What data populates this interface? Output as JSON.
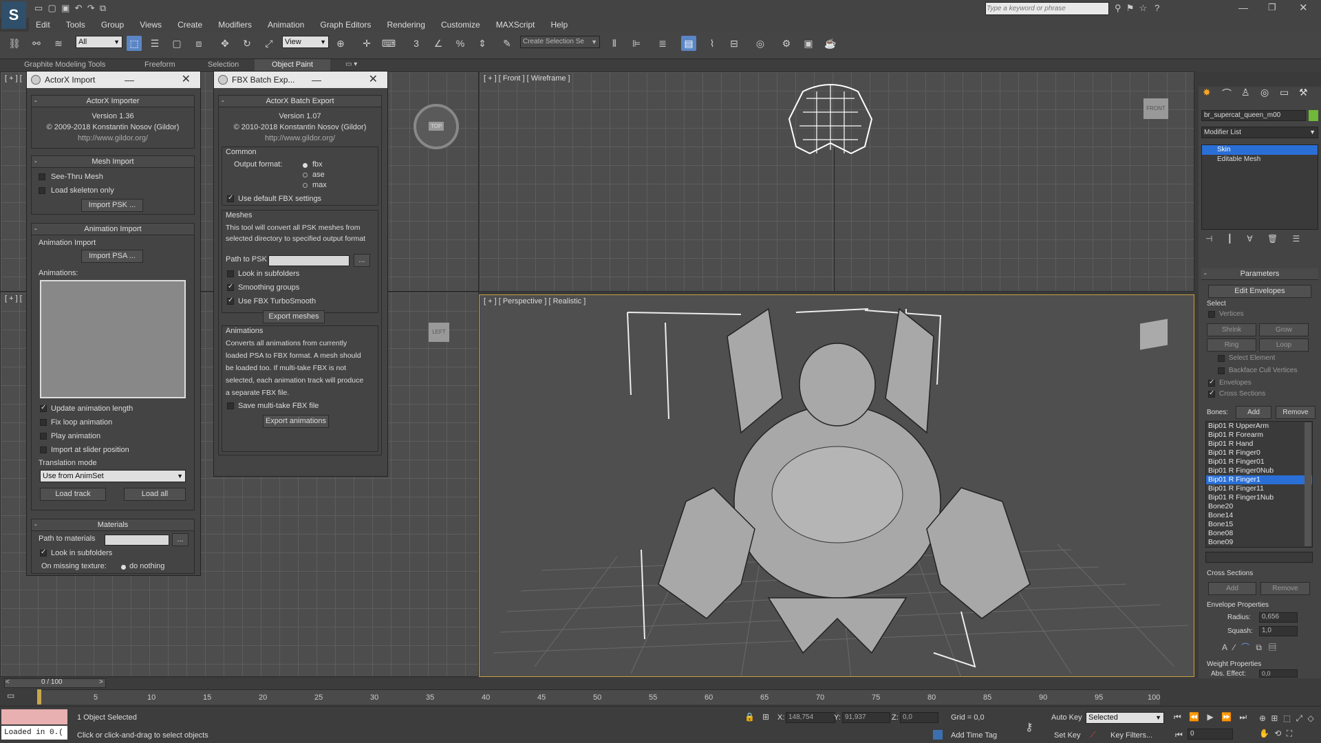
{
  "app": {
    "search_placeholder": "Type a keyword or phrase",
    "accent": "#5b86c5"
  },
  "menu": [
    "Edit",
    "Tools",
    "Group",
    "Views",
    "Create",
    "Modifiers",
    "Animation",
    "Graph Editors",
    "Rendering",
    "Customize",
    "MAXScript",
    "Help"
  ],
  "toolbar": {
    "selection_filter": "All",
    "ref_coord": "View",
    "named_selection": "Create Selection Se"
  },
  "ribbon_tabs": [
    "Graphite Modeling Tools",
    "Freeform",
    "Selection",
    "Object Paint"
  ],
  "viewports": {
    "front_label": "[ + ] [ Front ] [ Wireframe ]",
    "persp_label": "[ + ] [ Perspective ] [ Realistic ]",
    "tl_label": "[ + ] [",
    "ml_label": "[ + ] [",
    "front_cube": "FRONT",
    "top_cube": "TOP",
    "left_cube": "LEFT"
  },
  "actorx": {
    "title": "ActorX Import",
    "header": "ActorX Importer",
    "version": "Version 1.36",
    "copyright": "© 2009-2018 Konstantin Nosov (Gildor)",
    "url": "http://www.gildor.org/",
    "mesh_import": "Mesh Import",
    "see_thru": "See-Thru Mesh",
    "load_skeleton": "Load skeleton only",
    "import_psk": "Import PSK ...",
    "animation_import": "Animation Import",
    "anim_import_sub": "Animation Import",
    "import_psa": "Import PSA ...",
    "animations": "Animations:",
    "update_len": "Update animation length",
    "fix_loop": "Fix loop animation",
    "play_anim": "Play animation",
    "import_slider": "Import at slider position",
    "translation_mode": "Translation mode",
    "translation_value": "Use from AnimSet",
    "load_track": "Load track",
    "load_all": "Load all",
    "materials": "Materials",
    "path_materials": "Path to materials",
    "browse": "...",
    "look_sub": "Look in subfolders",
    "on_missing": "On missing texture:",
    "do_nothing": "do nothing"
  },
  "fbx": {
    "title": "FBX Batch Exp...",
    "header": "ActorX Batch Export",
    "version": "Version 1.07",
    "copyright": "© 2010-2018 Konstantin Nosov (Gildor)",
    "url": "http://www.gildor.org/",
    "common": "Common",
    "output_format": "Output format:",
    "formats": [
      "fbx",
      "ase",
      "max"
    ],
    "use_default": "Use default FBX settings",
    "meshes": "Meshes",
    "meshes_desc1": "This tool will convert all PSK meshes from",
    "meshes_desc2": "selected directory to specified output format",
    "path_psk": "Path to PSK",
    "browse": "...",
    "look_sub": "Look in subfolders",
    "smoothing": "Smoothing groups",
    "turbosmooth": "Use FBX TurboSmooth",
    "export_meshes": "Export meshes",
    "animations": "Animations",
    "anim_desc": [
      "Converts all animations from currently",
      "loaded PSA to FBX format. A mesh should",
      "be loaded too. If multi-take FBX is not",
      "selected, each animation track will produce",
      "a separate FBX file."
    ],
    "save_multi": "Save multi-take FBX file",
    "export_anims": "Export animations"
  },
  "cmd": {
    "object_name": "br_supercat_queen_m00",
    "modifier_list": "Modifier List",
    "stack": [
      "Skin",
      "Editable Mesh"
    ],
    "parameters": "Parameters",
    "edit_envelopes": "Edit Envelopes",
    "select": "Select",
    "vertices": "Vertices",
    "shrink": "Shrink",
    "grow": "Grow",
    "ring": "Ring",
    "loop": "Loop",
    "select_element": "Select Element",
    "backface": "Backface Cull Vertices",
    "envelopes": "Envelopes",
    "cross_sections": "Cross Sections",
    "bones_label": "Bones:",
    "add": "Add",
    "remove": "Remove",
    "bones": [
      "Bip01 R UpperArm",
      "Bip01 R Forearm",
      "Bip01 R Hand",
      "Bip01 R Finger0",
      "Bip01 R Finger01",
      "Bip01 R Finger0Nub",
      "Bip01 R Finger1",
      "Bip01 R Finger11",
      "Bip01 R Finger1Nub",
      "Bone20",
      "Bone14",
      "Bone15",
      "Bone08",
      "Bone09"
    ],
    "selected_bone_index": 6,
    "cross_sections_title": "Cross Sections",
    "cs_add": "Add",
    "cs_remove": "Remove",
    "envelope_props": "Envelope Properties",
    "radius_label": "Radius:",
    "radius": "0,656",
    "squash_label": "Squash:",
    "squash": "1,0",
    "weight_props": "Weight Properties",
    "abs_effect": "Abs. Effect:",
    "abs_value": "0,0"
  },
  "timeline": {
    "frame": "0 / 100",
    "ticks": [
      "5",
      "10",
      "15",
      "20",
      "25",
      "30",
      "35",
      "40",
      "45",
      "50",
      "55",
      "60",
      "65",
      "70",
      "75",
      "80",
      "85",
      "90",
      "95",
      "100"
    ]
  },
  "status": {
    "loaded": "Loaded in 0.(",
    "selected": "1 Object Selected",
    "prompt": "Click or click-and-drag to select objects",
    "x_label": "X:",
    "x": "148,754",
    "y_label": "Y:",
    "y": "91,937",
    "z_label": "Z:",
    "z": "0,0",
    "grid": "Grid = 0,0",
    "add_time_tag": "Add Time Tag",
    "auto_key": "Auto Key",
    "set_key": "Set Key",
    "key_mode": "Selected",
    "key_filters": "Key Filters...",
    "frame_field": "0"
  }
}
